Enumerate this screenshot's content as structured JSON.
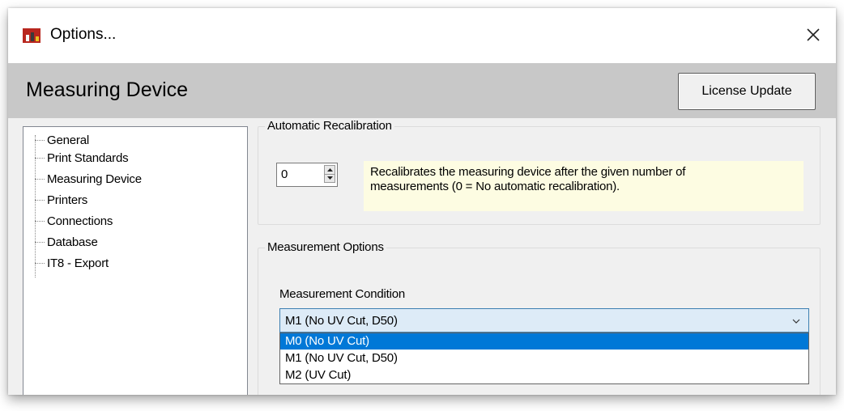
{
  "window": {
    "title": "Options...",
    "close_symbol": "×",
    "icon": "app-chart-icon",
    "colors": {
      "header_bg": "#c8c8c8",
      "selection": "#0078d7",
      "info_bg": "#fdfce2"
    }
  },
  "header": {
    "title": "Measuring Device",
    "license_button": "License Update"
  },
  "tree": {
    "items": [
      {
        "label": "General"
      },
      {
        "label": "Print Standards"
      },
      {
        "label": "Measuring Device"
      },
      {
        "label": "Printers"
      },
      {
        "label": "Connections"
      },
      {
        "label": "Database"
      },
      {
        "label": "IT8 - Export"
      }
    ]
  },
  "recalibration": {
    "group_title": "Automatic Recalibration",
    "spinner_value": "0",
    "info_line1": "Recalibrates the measuring device after the given number of",
    "info_line2": "measurements (0 = No automatic recalibration)."
  },
  "measurement": {
    "group_title": "Measurement Options",
    "condition_label": "Measurement Condition",
    "selected": "M1 (No UV Cut, D50)",
    "options": [
      {
        "label": "M0 (No UV Cut)",
        "highlighted": true
      },
      {
        "label": "M1 (No UV Cut, D50)",
        "highlighted": false
      },
      {
        "label": "M2 (UV Cut)",
        "highlighted": false
      }
    ]
  }
}
